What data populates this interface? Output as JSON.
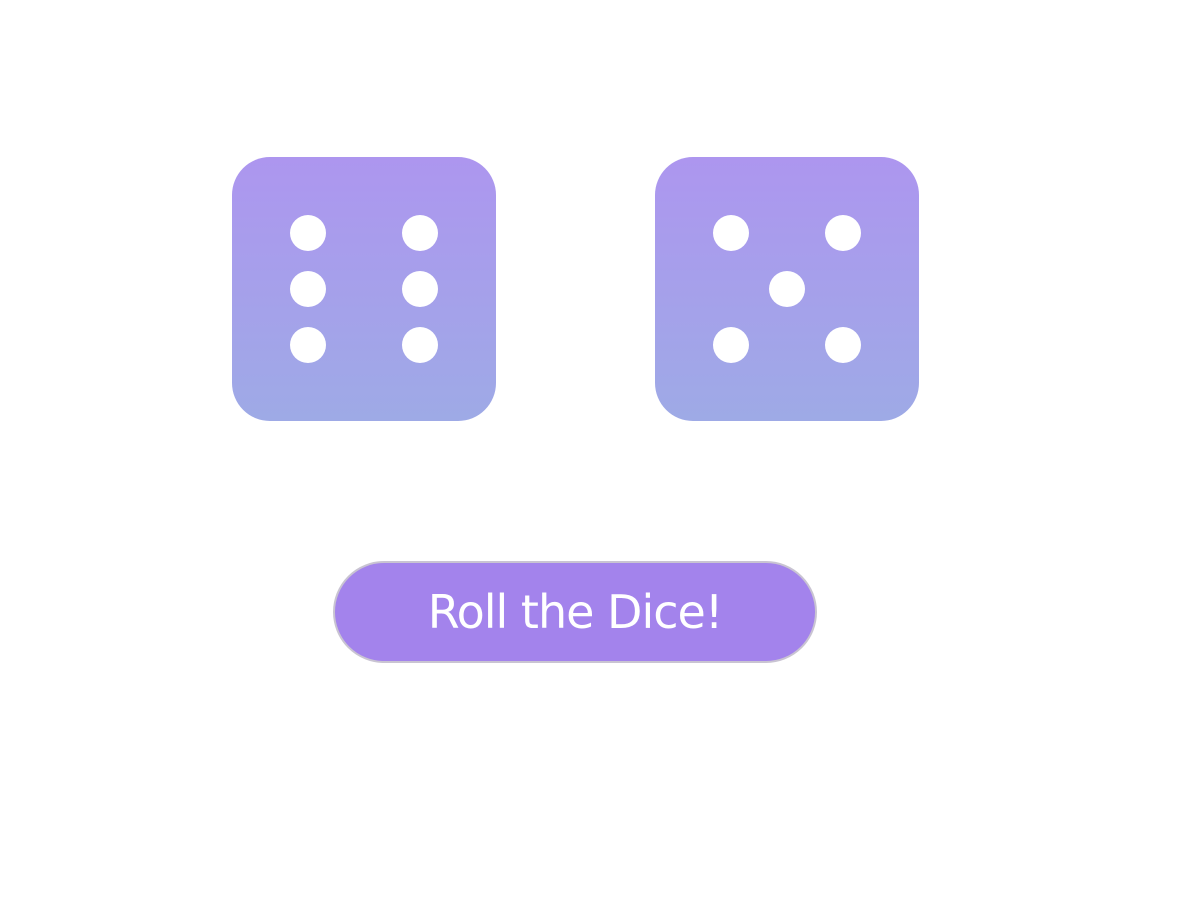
{
  "dice": [
    {
      "name": "left",
      "value": 6
    },
    {
      "name": "right",
      "value": 5
    }
  ],
  "colors": {
    "die_gradient_top": "#ad96ef",
    "die_gradient_bottom": "#9eaae6",
    "pip": "#ffffff",
    "button_background": "#a383ec",
    "button_border": "#c9c4d2",
    "button_text": "#ffffff",
    "page_background": "#ffffff"
  },
  "roll_button": {
    "label": "Roll the Dice!"
  }
}
